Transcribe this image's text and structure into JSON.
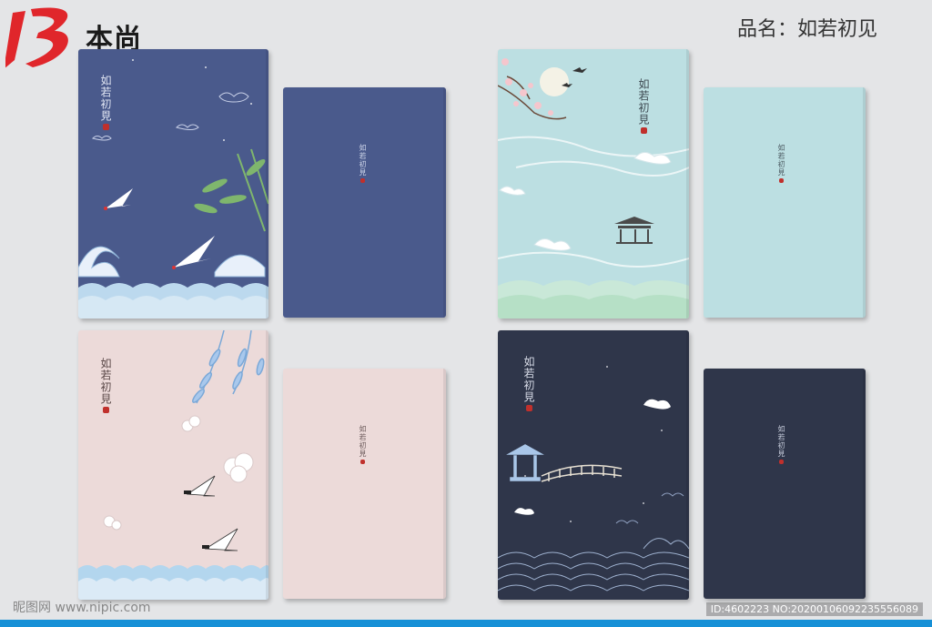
{
  "brand": {
    "logo_mark": "B",
    "name": "本尚"
  },
  "product": {
    "label": "品名",
    "separator": "：",
    "name": "如若初见"
  },
  "cover_title": "如若初見",
  "colors": {
    "navy": "#4a5a8c",
    "mint": "#bcdfe2",
    "blush": "#ecdad9",
    "charcoal": "#2f364a",
    "seal": "#c0302c",
    "accent_bar": "#1690d6"
  },
  "watermark": {
    "site": "昵图网 www.nipic.com",
    "id_line": "ID:4602223 NO:20200106092235556089"
  }
}
